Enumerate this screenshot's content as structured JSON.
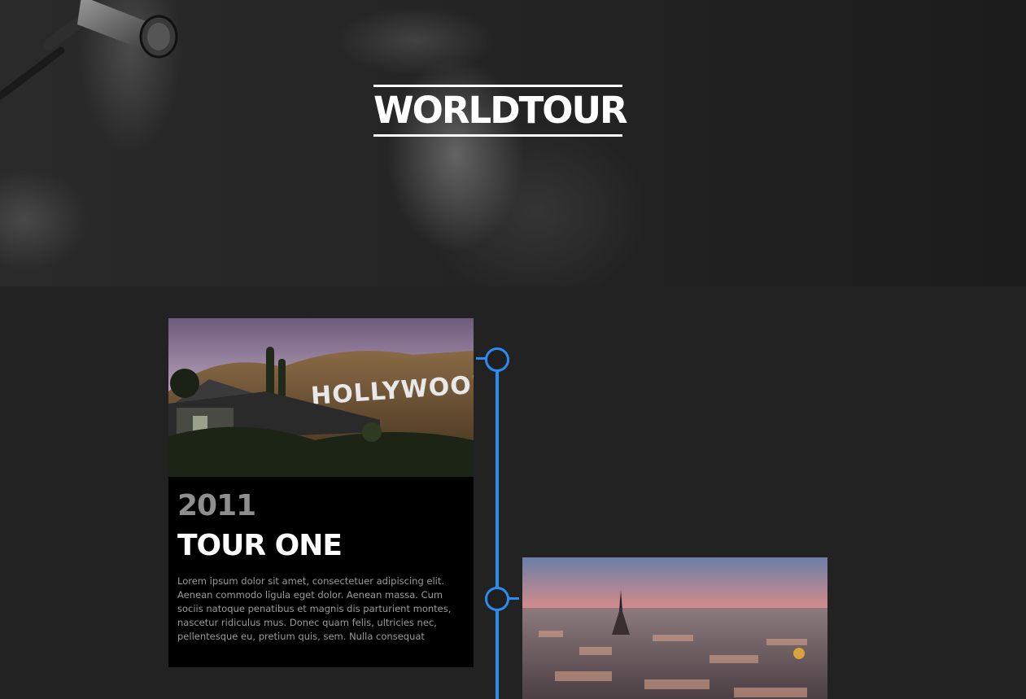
{
  "hero": {
    "title": "WORLDTOUR"
  },
  "timeline": {
    "accent_color": "#2a8cf0",
    "entries": [
      {
        "year": "2011",
        "title": "TOUR ONE",
        "image_subject": "hollywood-sign",
        "description": "Lorem ipsum dolor sit amet, consectetuer adipiscing elit. Aenean commodo ligula eget dolor. Aenean massa. Cum sociis natoque penatibus et magnis dis parturient montes, nascetur ridiculus mus. Donec quam felis, ultricies nec, pellentesque eu, pretium quis, sem. Nulla consequat"
      },
      {
        "image_subject": "paris-skyline"
      }
    ]
  }
}
